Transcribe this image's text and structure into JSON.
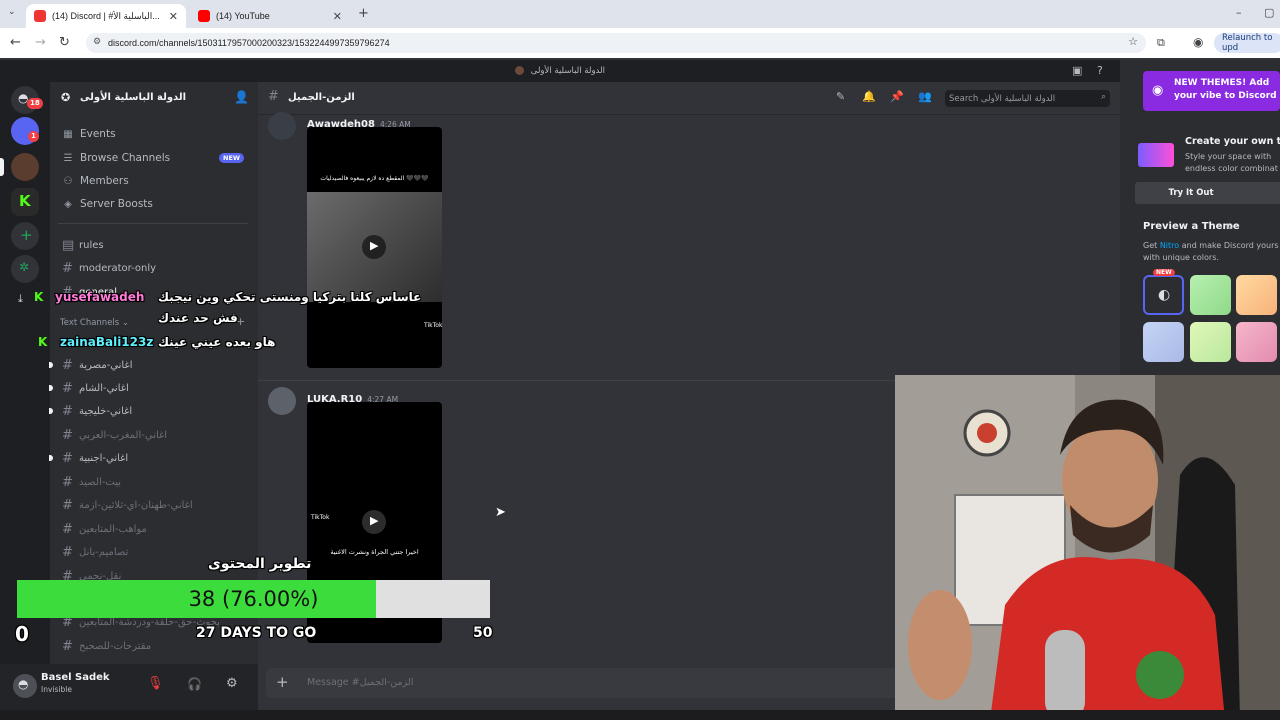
{
  "browser": {
    "tabs": [
      {
        "label": "(14) Discord | #الباسلية الأ...",
        "active": true
      },
      {
        "label": "(14) YouTube",
        "active": false
      }
    ],
    "url": "discord.com/channels/1503117957000200323/1532244997359796274",
    "relaunch": "Relaunch to upd"
  },
  "discord": {
    "window_title": "الدولة الباسلية الأولى",
    "server_name": "الدولة الباسلية الأولى",
    "rail_badges": {
      "home": "18",
      "discord": "1"
    },
    "nav": [
      {
        "label": "Events",
        "icon": "calendar-icon"
      },
      {
        "label": "Browse Channels",
        "icon": "browse-icon"
      },
      {
        "label": "Members",
        "icon": "members-icon"
      },
      {
        "label": "Server Boosts",
        "icon": "boost-icon"
      }
    ],
    "new_badge": "NEW",
    "channels_top": [
      "rules",
      "moderator-only",
      "general"
    ],
    "category": "Text Channels",
    "channels": [
      "اغاني-مصرية",
      "اغاني-الشام",
      "اغاني-خليجية",
      "اغاني-المغرب-العربي",
      "اغاني-اجنبية",
      "بيت-الصيد",
      "اغاني-طهنان-اي-ثلاثين-ازمة",
      "مواهب-المتابعين",
      "تصاميم-بانل",
      "نقل-نحمي",
      "بحوث-حق-حلقة-ودردشة-المتابعين",
      "مقترحات-للصحبح"
    ],
    "chat_channel": "الزمن-الجميل",
    "search_placeholder": "Search الدولة الباسلية الأولى",
    "messages": [
      {
        "author": "Awawdeh08",
        "time": "4:26 AM",
        "video_caption": "المقطع ده لازم يبيعوه فالصيدليات 🖤🖤🖤",
        "watermark": "TikTok"
      },
      {
        "author": "LUKA.R10",
        "time": "4:27 AM",
        "video_caption": "اخيرا جتني الجراة ونشرت الاغنية",
        "watermark": "TikTok"
      }
    ],
    "composer_placeholder": "Message #الزمن-الجميل",
    "user": {
      "name": "Basel Sadek",
      "status": "Invisible"
    },
    "promo": {
      "banner": "NEW THEMES! Add your vibe to Discord",
      "card_title": "Create your own the",
      "card_body": "Style your space with endless color combinat",
      "try_button": "Try It Out",
      "preview_title": "Preview a Theme",
      "preview_body_1": "Get ",
      "preview_nitro": "Nitro",
      "preview_body_2": " and make Discord yours with unique colors.",
      "swatch_new": "NEW"
    }
  },
  "overlay": {
    "chat1_user": "yusefawadeh",
    "chat1_text": "عاساس كلنا بتركيا ومنستى تحكي وين نيجبك",
    "chat1_text2": "فش حد عندك",
    "chat2_user": "zainaBali123z",
    "chat2_text": "هاو بعده عيني عينك",
    "goal_title": "تطوير المحتوى",
    "goal_progress": 0.76,
    "goal_label": "38 (76.00%)",
    "goal_min": "0",
    "goal_max": "50",
    "goal_days": "27 DAYS TO GO"
  },
  "colors": {
    "discord_bg": "#313338",
    "sidebar": "#2b2d31",
    "rail": "#1e1f22",
    "blurple": "#5865f2",
    "goal_fill": "#3ddc3d",
    "purple_promo": "#8a2be2"
  }
}
